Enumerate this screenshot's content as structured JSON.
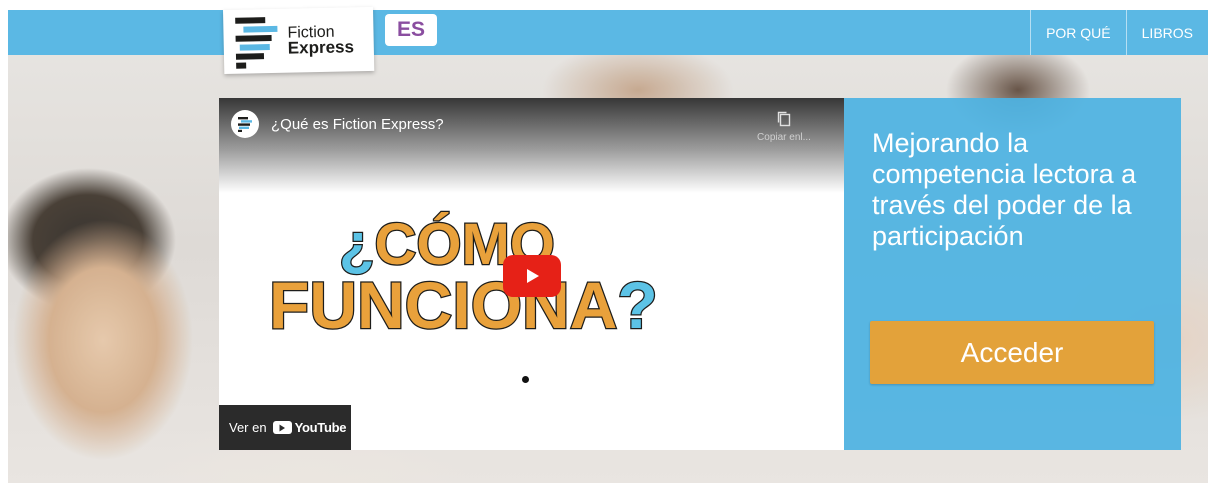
{
  "header": {
    "logo": {
      "line1": "Fiction",
      "line2": "Express"
    },
    "language_button": "ES",
    "nav": [
      {
        "label": "POR QUÉ"
      },
      {
        "label": "LIBROS"
      }
    ]
  },
  "video": {
    "title": "¿Qué es Fiction Express?",
    "copy_link_label": "Copiar enl...",
    "thumbnail_heading_line1": "¿CÓMO",
    "thumbnail_heading_line2": "FUNCIONA?",
    "watch_on_label": "Ver en",
    "youtube_label": "YouTube"
  },
  "panel": {
    "tagline": "Mejorando la competencia lectora a través del poder de la participación",
    "cta_label": "Acceder"
  },
  "colors": {
    "nav_blue": "#5bb8e4",
    "panel_blue": "#4db3e2",
    "cta_orange": "#e3a23a",
    "brand_purple": "#8a4ea0",
    "play_red": "#e62117",
    "thumbnail_text_orange": "#e9a13b",
    "thumbnail_question_blue": "#5cc3e6"
  }
}
